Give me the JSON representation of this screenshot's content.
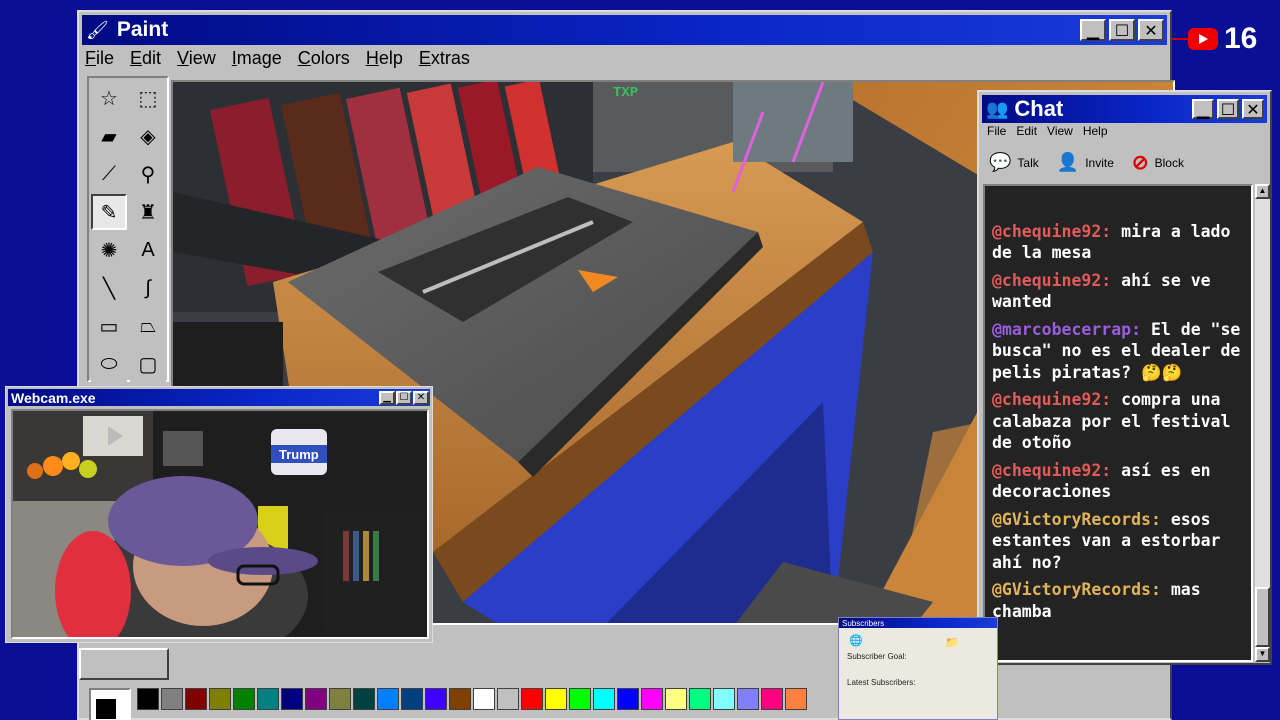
{
  "paint": {
    "title": "Paint",
    "menu": [
      "File",
      "Edit",
      "View",
      "Image",
      "Colors",
      "Help",
      "Extras"
    ],
    "tools": [
      {
        "name": "free-select-icon",
        "glyph": "☆"
      },
      {
        "name": "rect-select-icon",
        "glyph": "⬚"
      },
      {
        "name": "eraser-icon",
        "glyph": "▰"
      },
      {
        "name": "fill-bucket-icon",
        "glyph": "◈"
      },
      {
        "name": "color-picker-icon",
        "glyph": "⟋"
      },
      {
        "name": "magnifier-icon",
        "glyph": "⚲"
      },
      {
        "name": "pencil-icon",
        "glyph": "✎"
      },
      {
        "name": "brush-icon",
        "glyph": "♜"
      },
      {
        "name": "airbrush-icon",
        "glyph": "✺"
      },
      {
        "name": "text-icon",
        "glyph": "A"
      },
      {
        "name": "line-icon",
        "glyph": "╲"
      },
      {
        "name": "curve-icon",
        "glyph": "∫"
      },
      {
        "name": "rectangle-icon",
        "glyph": "▭"
      },
      {
        "name": "polygon-icon",
        "glyph": "⏢"
      },
      {
        "name": "ellipse-icon",
        "glyph": "⬭"
      },
      {
        "name": "rounded-rect-icon",
        "glyph": "▢"
      }
    ],
    "active_tool_index": 6,
    "palette": [
      "#000000",
      "#808080",
      "#800000",
      "#808000",
      "#008000",
      "#008080",
      "#000080",
      "#800080",
      "#808040",
      "#004040",
      "#0080ff",
      "#004080",
      "#4000ff",
      "#804000",
      "#ffffff",
      "#c0c0c0",
      "#ff0000",
      "#ffff00",
      "#00ff00",
      "#00ffff",
      "#0000ff",
      "#ff00ff",
      "#ffff80",
      "#00ff80",
      "#80ffff",
      "#8080ff",
      "#ff0080",
      "#ff8040"
    ],
    "foreground_color": "#000000"
  },
  "chat": {
    "title": "Chat",
    "menu": [
      "File",
      "Edit",
      "View",
      "Help"
    ],
    "toolbar": [
      {
        "label": "Talk",
        "icon": "talk-icon"
      },
      {
        "label": "Invite",
        "icon": "invite-icon"
      },
      {
        "label": "Block",
        "icon": "block-icon"
      }
    ],
    "messages": [
      {
        "user": "@chequine92:",
        "text": "mira a lado de la mesa",
        "color": "red"
      },
      {
        "user": "@chequine92:",
        "text": "ahí se ve wanted",
        "color": "red"
      },
      {
        "user": "@marcobecerrap:",
        "text": "El de \"se busca\" no es el dealer de pelis piratas? 🤔🤔",
        "color": "purple"
      },
      {
        "user": "@chequine92:",
        "text": "compra una calabaza por el festival de otoño",
        "color": "red"
      },
      {
        "user": "@chequine92:",
        "text": "así es en decoraciones",
        "color": "red"
      },
      {
        "user": "@GVictoryRecords:",
        "text": "esos estantes van a estorbar ahí no?",
        "color": "gold"
      },
      {
        "user": "@GVictoryRecords:",
        "text": "mas chamba",
        "color": "gold"
      }
    ]
  },
  "webcam": {
    "title": "Webcam.exe",
    "poster_text": "Trump"
  },
  "subscribers": {
    "title": "Subscribers",
    "goal_label": "Subscriber Goal:",
    "latest_label": "Latest Subscribers:"
  },
  "badge": {
    "count": "16"
  },
  "game": {
    "hud_text": "TXP"
  }
}
